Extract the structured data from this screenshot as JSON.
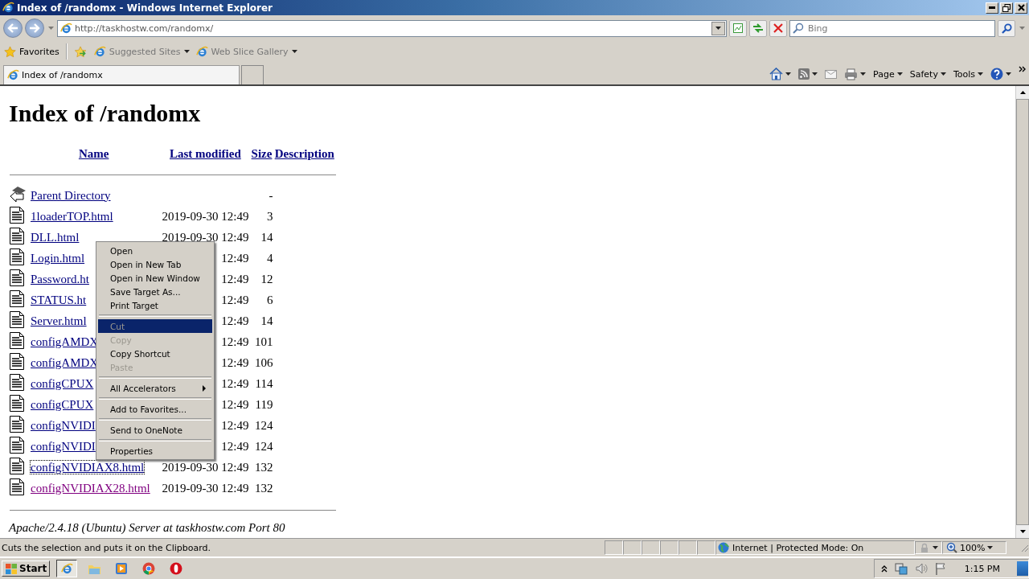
{
  "window": {
    "title": "Index of /randomx - Windows Internet Explorer"
  },
  "address_bar": {
    "url": "http://taskhostw.com/randomx/"
  },
  "search": {
    "placeholder": "Bing"
  },
  "favorites_bar": {
    "label": "Favorites",
    "links": [
      "Suggested Sites",
      "Web Slice Gallery"
    ]
  },
  "tabs": [
    {
      "label": "Index of /randomx",
      "selected": true
    }
  ],
  "command_bar": [
    "Page",
    "Safety",
    "Tools"
  ],
  "page": {
    "heading": "Index of /randomx",
    "columns": [
      "Name",
      "Last modified",
      "Size",
      "Description"
    ],
    "rows": [
      {
        "kind": "parent",
        "name": "Parent Directory",
        "modified": "",
        "size": "-",
        "visited": false,
        "focused": false
      },
      {
        "kind": "file",
        "name": "1loaderTOP.html",
        "modified": "2019-09-30 12:49",
        "size": "3",
        "visited": false,
        "focused": false
      },
      {
        "kind": "file",
        "name": "DLL.html",
        "modified": "2019-09-30 12:49",
        "size": "14",
        "visited": false,
        "focused": false
      },
      {
        "kind": "file",
        "name": "Login.html",
        "modified": "12:49",
        "size": "4",
        "visited": false,
        "focused": false
      },
      {
        "kind": "file",
        "name": "Password.ht",
        "modified": "12:49",
        "size": "12",
        "visited": false,
        "focused": false
      },
      {
        "kind": "file",
        "name": "STATUS.ht",
        "modified": "12:49",
        "size": "6",
        "visited": false,
        "focused": false
      },
      {
        "kind": "file",
        "name": "Server.html",
        "modified": "12:49",
        "size": "14",
        "visited": false,
        "focused": false
      },
      {
        "kind": "file",
        "name": "configAMDX",
        "modified": "12:49",
        "size": "101",
        "visited": false,
        "focused": false
      },
      {
        "kind": "file",
        "name": "configAMDX",
        "modified": "12:49",
        "size": "106",
        "visited": false,
        "focused": false
      },
      {
        "kind": "file",
        "name": "configCPUX",
        "modified": "12:49",
        "size": "114",
        "visited": false,
        "focused": false
      },
      {
        "kind": "file",
        "name": "configCPUX",
        "modified": "12:49",
        "size": "119",
        "visited": false,
        "focused": false
      },
      {
        "kind": "file",
        "name": "configNVIDI",
        "modified": "12:49",
        "size": "124",
        "visited": false,
        "focused": false
      },
      {
        "kind": "file",
        "name": "configNVIDI",
        "modified": "12:49",
        "size": "124",
        "visited": false,
        "focused": false
      },
      {
        "kind": "file",
        "name": "configNVIDIAX8.html",
        "modified": "2019-09-30 12:49",
        "size": "132",
        "visited": false,
        "focused": true
      },
      {
        "kind": "file",
        "name": "configNVIDIAX28.html",
        "modified": "2019-09-30 12:49",
        "size": "132",
        "visited": true,
        "focused": false
      }
    ],
    "footer": "Apache/2.4.18 (Ubuntu) Server at taskhostw.com Port 80"
  },
  "context_menu": [
    {
      "kind": "item",
      "label": "Open",
      "disabled": false,
      "selected": false
    },
    {
      "kind": "item",
      "label": "Open in New Tab",
      "disabled": false,
      "selected": false
    },
    {
      "kind": "item",
      "label": "Open in New Window",
      "disabled": false,
      "selected": false
    },
    {
      "kind": "item",
      "label": "Save Target As...",
      "disabled": false,
      "selected": false
    },
    {
      "kind": "item",
      "label": "Print Target",
      "disabled": false,
      "selected": false
    },
    {
      "kind": "separator"
    },
    {
      "kind": "item",
      "label": "Cut",
      "disabled": true,
      "selected": true
    },
    {
      "kind": "item",
      "label": "Copy",
      "disabled": true,
      "selected": false
    },
    {
      "kind": "item",
      "label": "Copy Shortcut",
      "disabled": false,
      "selected": false
    },
    {
      "kind": "item",
      "label": "Paste",
      "disabled": true,
      "selected": false
    },
    {
      "kind": "separator"
    },
    {
      "kind": "submenu",
      "label": "All Accelerators",
      "disabled": false,
      "selected": false
    },
    {
      "kind": "separator"
    },
    {
      "kind": "item",
      "label": "Add to Favorites...",
      "disabled": false,
      "selected": false
    },
    {
      "kind": "separator"
    },
    {
      "kind": "item",
      "label": "Send to OneNote",
      "disabled": false,
      "selected": false
    },
    {
      "kind": "separator"
    },
    {
      "kind": "item",
      "label": "Properties",
      "disabled": false,
      "selected": false
    }
  ],
  "status_bar": {
    "message": "Cuts the selection and puts it on the Clipboard.",
    "zone": "Internet | Protected Mode: On",
    "zoom": "100%"
  },
  "taskbar": {
    "start": "Start",
    "clock": "1:15 PM"
  }
}
